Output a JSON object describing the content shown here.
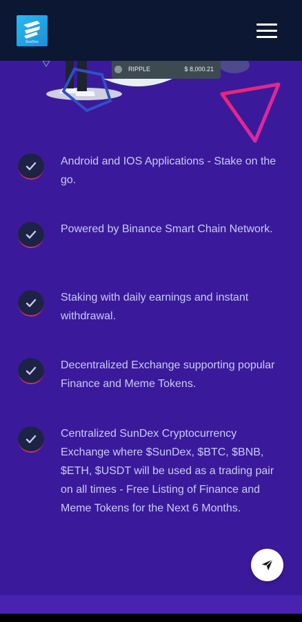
{
  "header": {
    "logo_caption": "SunDex",
    "logo_icon": "sundex-logo",
    "menu_icon": "hamburger-menu-icon"
  },
  "hero": {
    "ticker_name": "RIPPLE",
    "ticker_price": "$ 8,000.21"
  },
  "features": [
    {
      "text": "Android and IOS Applications - Stake on the go.",
      "icon": "checkmark-icon"
    },
    {
      "text": "Powered by Binance Smart Chain Network.",
      "icon": "checkmark-icon"
    },
    {
      "text": "Staking with daily earnings and instant withdrawal.",
      "icon": "checkmark-icon"
    },
    {
      "text": "Decentralized Exchange supporting popular Finance and Meme Tokens.",
      "icon": "checkmark-icon"
    },
    {
      "text": "Centralized SunDex Cryptocurrency Exchange where $SunDex, $BTC, $BNB, $ETH, $USDT will be used as a trading pair on all times - Free Listing of Finance and Meme Tokens for the Next 6 Months.",
      "icon": "checkmark-icon"
    }
  ],
  "fab": {
    "icon": "send-icon"
  },
  "colors": {
    "background": "#3a1a9a",
    "header": "#0b1733",
    "text": "#c9cbf3",
    "accent": "#d1345b"
  }
}
